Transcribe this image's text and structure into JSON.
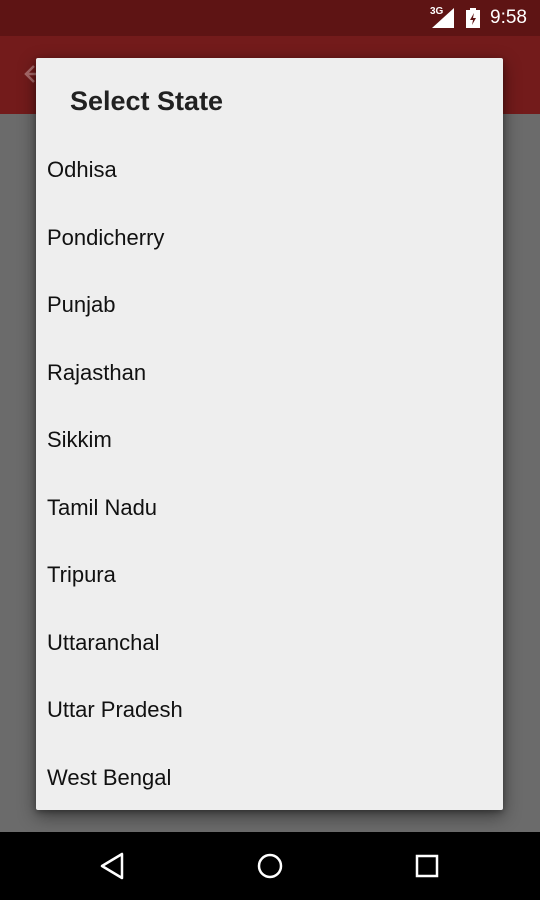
{
  "status_bar": {
    "network": "3G",
    "time": "9:58"
  },
  "dialog": {
    "title": "Select State",
    "items": [
      "Odhisa",
      "Pondicherry",
      "Punjab",
      "Rajasthan",
      "Sikkim",
      "Tamil Nadu",
      "Tripura",
      "Uttaranchal",
      "Uttar Pradesh",
      "West Bengal"
    ]
  },
  "nav_bar": {
    "icons": [
      "back-triangle-icon",
      "home-circle-icon",
      "recents-square-icon"
    ]
  },
  "colors": {
    "status_bar": "#5e1414",
    "app_bar": "#731b1b",
    "scrim": "#6b6b6b",
    "dialog": "#eeeeee",
    "nav_bar": "#000000"
  }
}
